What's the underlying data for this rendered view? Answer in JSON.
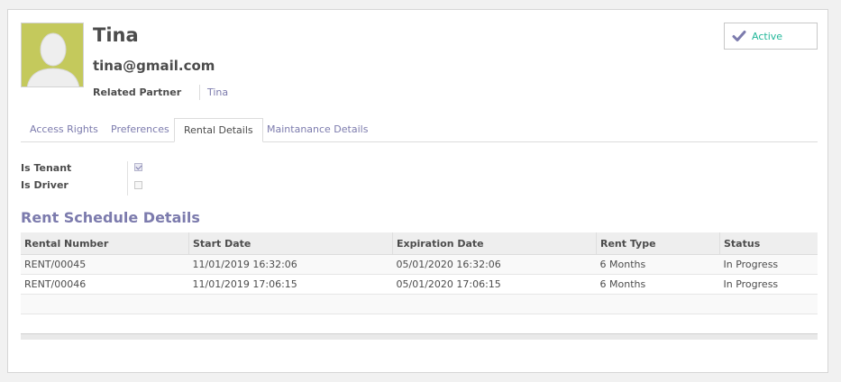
{
  "record": {
    "name": "Tina",
    "email": "tina@gmail.com",
    "related_partner_label": "Related Partner",
    "related_partner_value": "Tina",
    "status_label": "Active"
  },
  "colors": {
    "accent": "#7c7bad",
    "status": "#21b799",
    "avatar_bg": "#c4c95c"
  },
  "tabs": [
    {
      "label": "Access Rights",
      "active": false
    },
    {
      "label": "Preferences",
      "active": false
    },
    {
      "label": "Rental Details",
      "active": true
    },
    {
      "label": "Maintanance Details",
      "active": false
    }
  ],
  "fields": {
    "is_tenant": {
      "label": "Is Tenant",
      "checked": true
    },
    "is_driver": {
      "label": "Is Driver",
      "checked": false
    }
  },
  "rent_schedule": {
    "title": "Rent Schedule Details",
    "columns": [
      "Rental Number",
      "Start Date",
      "Expiration Date",
      "Rent Type",
      "Status"
    ],
    "rows": [
      [
        "RENT/00045",
        "11/01/2019 16:32:06",
        "05/01/2020 16:32:06",
        "6 Months",
        "In Progress"
      ],
      [
        "RENT/00046",
        "11/01/2019 17:06:15",
        "05/01/2020 17:06:15",
        "6 Months",
        "In Progress"
      ]
    ]
  },
  "icons": {
    "avatar": "person-silhouette-icon",
    "status": "check-icon"
  }
}
